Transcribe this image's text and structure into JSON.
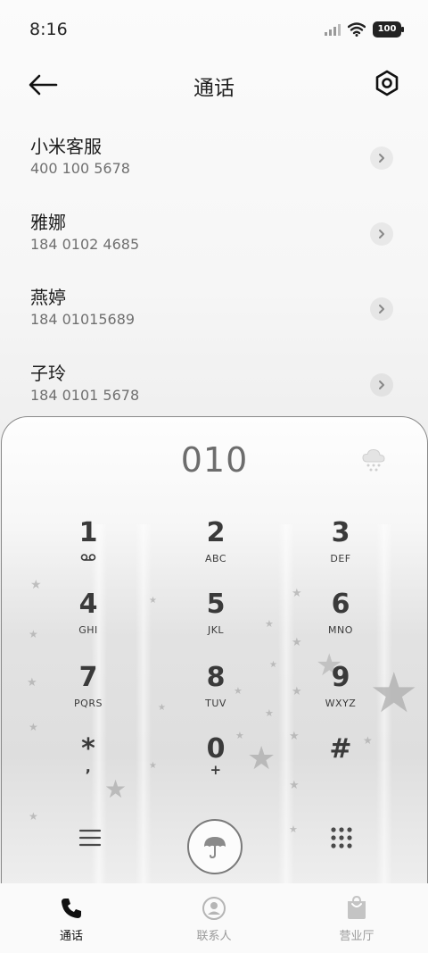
{
  "status_bar": {
    "time": "8:16",
    "battery": "100"
  },
  "header": {
    "title": "通话"
  },
  "contacts": [
    {
      "name": "小米客服",
      "number": "400 100 5678"
    },
    {
      "name": "雅娜",
      "number": "184 0102 4685"
    },
    {
      "name": "燕婷",
      "number": "184 01015689"
    },
    {
      "name": "子玲",
      "number": "184 0101 5678"
    }
  ],
  "dialpad": {
    "display": "010",
    "keys": [
      {
        "digit": "1",
        "letters": ""
      },
      {
        "digit": "2",
        "letters": "ABC"
      },
      {
        "digit": "3",
        "letters": "DEF"
      },
      {
        "digit": "4",
        "letters": "GHI"
      },
      {
        "digit": "5",
        "letters": "JKL"
      },
      {
        "digit": "6",
        "letters": "MNO"
      },
      {
        "digit": "7",
        "letters": "PQRS"
      },
      {
        "digit": "8",
        "letters": "TUV"
      },
      {
        "digit": "9",
        "letters": "WXYZ"
      },
      {
        "digit": "*",
        "letters": ","
      },
      {
        "digit": "0",
        "letters": "+"
      },
      {
        "digit": "#",
        "letters": ""
      }
    ]
  },
  "bottom_nav": {
    "items": [
      {
        "label": "通话",
        "icon": "phone-icon",
        "active": true
      },
      {
        "label": "联系人",
        "icon": "contact-icon",
        "active": false
      },
      {
        "label": "营业厅",
        "icon": "store-icon",
        "active": false
      }
    ]
  }
}
